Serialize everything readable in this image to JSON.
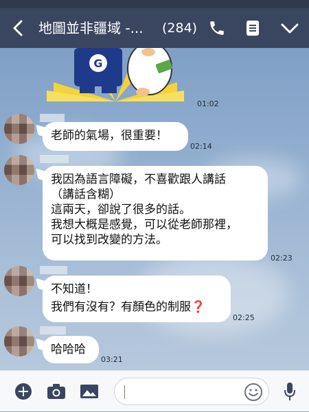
{
  "header": {
    "back_icon": "chevron-left-icon",
    "title": "地圖並非疆域 -...",
    "member_count": "(284)",
    "call_icon": "phone-icon",
    "notes_icon": "notes-icon",
    "menu_icon": "chevron-down-icon"
  },
  "sticker": {
    "time": "01:02",
    "tag_text": "G"
  },
  "messages": [
    {
      "lines": [
        "老師的氣場，很重要！"
      ],
      "time": "02:14"
    },
    {
      "lines": [
        "我因為語言障礙，不喜歡跟人講話",
        "（講話含糊）",
        "這兩天，卻說了很多的話。",
        "我想大概是感覺，可以從老師那裡，",
        "可以找到改變的方法。"
      ],
      "time": "02:23"
    },
    {
      "lines": [
        "不知道！",
        "我們有沒有？有顏色的制服"
      ],
      "emoji": "❓",
      "time": "02:25"
    },
    {
      "lines": [
        "哈哈哈"
      ],
      "time": "03:21"
    }
  ],
  "input": {
    "placeholder": "",
    "icons": [
      "plus-icon",
      "camera-icon",
      "image-icon",
      "emoji-icon",
      "mic-icon"
    ]
  }
}
